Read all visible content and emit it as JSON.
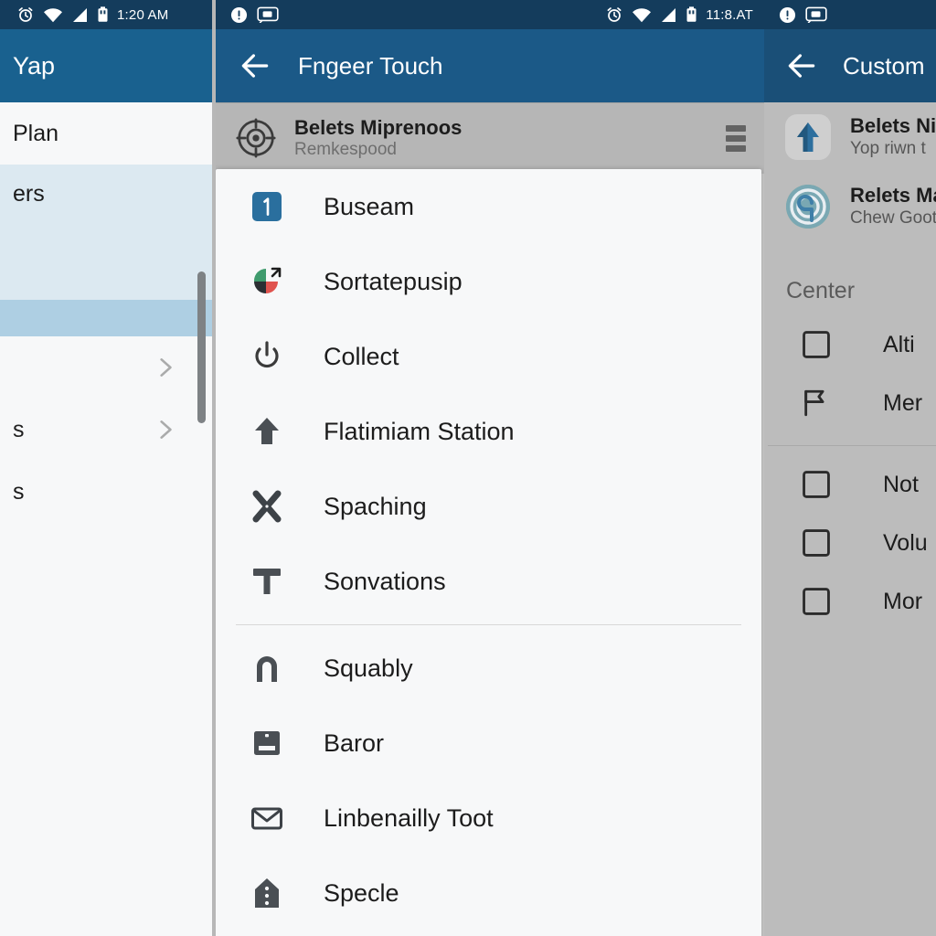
{
  "left_panel": {
    "statusbar": {
      "time": "1:20 AM",
      "icons": [
        "alarm-icon",
        "wifi-icon",
        "signal-icon",
        "battery-icon"
      ]
    },
    "appbar": {
      "title": "Yap"
    },
    "rows": [
      {
        "label": "Plan",
        "state": "normal"
      },
      {
        "label": "ers",
        "state": "selected-light"
      },
      {
        "label": "",
        "state": "selected-strong"
      },
      {
        "label": "",
        "state": "chevron"
      },
      {
        "label": "s",
        "state": "chevron"
      },
      {
        "label": "s",
        "state": "normal"
      }
    ]
  },
  "center_panel": {
    "statusbar": {
      "time": "11:8.AT",
      "left_icons": [
        "info-icon",
        "screenshot-icon"
      ],
      "right_icons": [
        "alarm-icon",
        "wifi-icon",
        "signal-icon",
        "battery-icon"
      ]
    },
    "appbar": {
      "back": "back-arrow",
      "title": "Fngeer Touch"
    },
    "selected_row": {
      "icon": "target-icon",
      "title": "Belets Miprenoos",
      "subtitle": "Remkespood",
      "handle": "drag-handle-icon"
    },
    "menu_items": [
      {
        "label": "Buseam",
        "icon": "badge-one-icon"
      },
      {
        "label": "Sortatepusip",
        "icon": "pie-share-icon"
      },
      {
        "label": "Collect",
        "icon": "power-icon"
      },
      {
        "label": "Flatimiam Station",
        "icon": "upload-icon"
      },
      {
        "label": "Spaching",
        "icon": "x-cross-icon"
      },
      {
        "label": "Sonvations",
        "icon": "funnel-icon"
      },
      {
        "label": "Squably",
        "icon": "arch-icon"
      },
      {
        "label": "Baror",
        "icon": "tray-icon"
      },
      {
        "label": "Linbenailly Toot",
        "icon": "envelope-icon"
      },
      {
        "label": "Specle",
        "icon": "tag-icon"
      }
    ],
    "divider_after_index": 5
  },
  "right_panel": {
    "statusbar": {
      "left_icons": [
        "info-icon",
        "screenshot-icon"
      ]
    },
    "appbar": {
      "back": "back-arrow",
      "title": "Custom"
    },
    "apps": [
      {
        "title": "Belets Nin",
        "subtitle": "Yop riwn t",
        "icon": "arrow-up-app-icon"
      },
      {
        "title": "Relets Ma",
        "subtitle": "Chew Goots",
        "icon": "radar-app-icon"
      }
    ],
    "section_title": "Center",
    "options_top": [
      {
        "label": "Alti",
        "icon": "checkbox-unchecked-icon"
      },
      {
        "label": "Mer",
        "icon": "flag-icon"
      }
    ],
    "options_bottom": [
      {
        "label": "Not",
        "icon": "checkbox-unchecked-icon"
      },
      {
        "label": "Volu",
        "icon": "checkbox-unchecked-icon"
      },
      {
        "label": "Mor",
        "icon": "checkbox-unchecked-icon"
      }
    ]
  },
  "colors": {
    "statusbar": "#143c5c",
    "appbar_left": "#19618f",
    "appbar_center": "#1b5987",
    "appbar_right": "#1a4f77",
    "accent_blue": "#2a6f9e",
    "selected_light": "#dce9f1",
    "selected_strong": "#aecfe3",
    "card_bg": "#f7f8f9",
    "right_bg": "#bcbcbc"
  }
}
